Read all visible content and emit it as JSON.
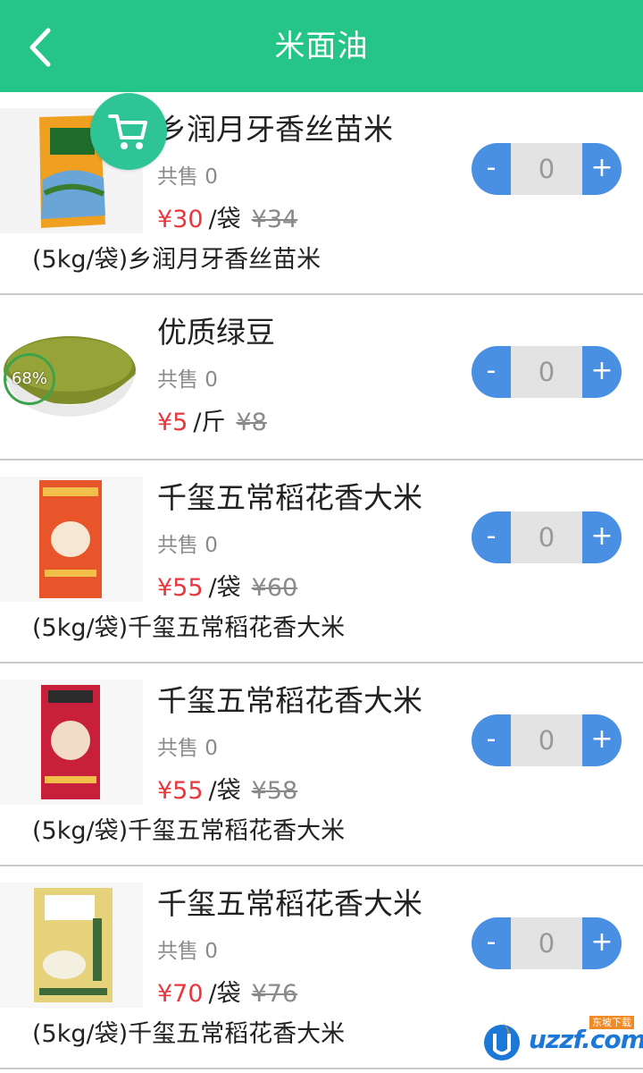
{
  "header": {
    "title": "米面油"
  },
  "products": [
    {
      "name": "乡润月牙香丝苗米",
      "sold": "共售 0",
      "price": "¥30",
      "unit": "/袋",
      "original_price": "¥34",
      "description": "(5kg/袋)乡润月牙香丝苗米",
      "quantity": "0",
      "minus": "-",
      "plus": "+"
    },
    {
      "name": "优质绿豆",
      "sold": "共售 0",
      "price": "¥5",
      "unit": "/斤",
      "original_price": "¥8",
      "description": "",
      "quantity": "0",
      "minus": "-",
      "plus": "+"
    },
    {
      "name": "千玺五常稻花香大米",
      "sold": "共售 0",
      "price": "¥55",
      "unit": "/袋",
      "original_price": "¥60",
      "description": "(5kg/袋)千玺五常稻花香大米",
      "quantity": "0",
      "minus": "-",
      "plus": "+"
    },
    {
      "name": "千玺五常稻花香大米",
      "sold": "共售 0",
      "price": "¥55",
      "unit": "/袋",
      "original_price": "¥58",
      "description": "(5kg/袋)千玺五常稻花香大米",
      "quantity": "0",
      "minus": "-",
      "plus": "+"
    },
    {
      "name": "千玺五常稻花香大米",
      "sold": "共售 0",
      "price": "¥70",
      "unit": "/袋",
      "original_price": "¥76",
      "description": "(5kg/袋)千玺五常稻花香大米",
      "quantity": "0",
      "minus": "-",
      "plus": "+"
    }
  ],
  "overlay": {
    "progress_badge": "68%"
  },
  "watermark": {
    "text": "uzzf.com",
    "sub": "东坡下载"
  },
  "colors": {
    "header": "#25c588",
    "accent_blue": "#4a90e2",
    "price_red": "#e8383d",
    "cart_fab": "#2ec495"
  }
}
